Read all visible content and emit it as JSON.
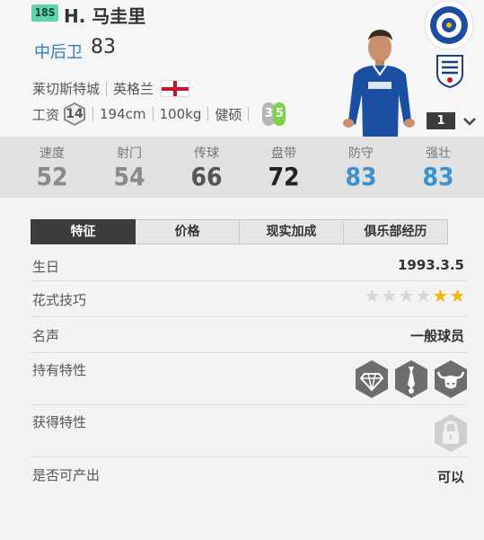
{
  "player": {
    "season": "18S",
    "name": "H. 马圭里",
    "position": "中后卫",
    "ovr": "83",
    "club": "莱切斯特城",
    "nation": "英格兰",
    "salary_label": "工资",
    "salary": "14",
    "height": "194cm",
    "weight": "100kg",
    "fitness_label": "健硕",
    "weak_foot_left": "3",
    "weak_foot_right": "5",
    "level": "1"
  },
  "stats": [
    {
      "label": "速度",
      "value": "52",
      "color": "#8a8a8a"
    },
    {
      "label": "射门",
      "value": "54",
      "color": "#8a8a8a"
    },
    {
      "label": "传球",
      "value": "66",
      "color": "#555555"
    },
    {
      "label": "盘带",
      "value": "72",
      "color": "#222222"
    },
    {
      "label": "防守",
      "value": "83",
      "color": "#3a93d0"
    },
    {
      "label": "强壮",
      "value": "83",
      "color": "#3a93d0"
    }
  ],
  "tabs": [
    "特征",
    "价格",
    "现实加成",
    "俱乐部经历"
  ],
  "details": {
    "birthday_label": "生日",
    "birthday": "1993.3.5",
    "skill_moves_label": "花式技巧",
    "skill_moves": 2,
    "skill_moves_max": 6,
    "reputation_label": "名声",
    "reputation": "一般球员",
    "traits_label": "持有特性",
    "traits": [
      "diamond-icon",
      "tie-icon",
      "buffalo-icon"
    ],
    "acquired_label": "获得特性",
    "acquired_traits": [
      "lock-icon"
    ],
    "produce_label": "是否可产出",
    "produce": "可以"
  },
  "colors": {
    "accent_blue": "#2f7cc0",
    "stat_blue": "#3a93d0",
    "season_badge": "#5fd4a8",
    "foot_right": "#7ed14a",
    "star_gold": "#f2b705"
  }
}
